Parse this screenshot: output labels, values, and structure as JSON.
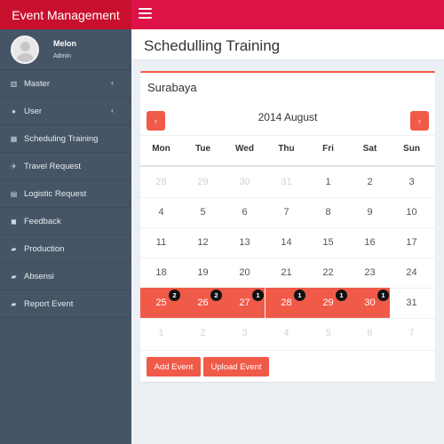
{
  "app": {
    "brand": "Event Management"
  },
  "user": {
    "name": "Melon",
    "role": "Admin"
  },
  "sidebar": {
    "items": [
      {
        "label": "Master",
        "icon": "bar-chart-icon",
        "glyph": "▥",
        "has_submenu": true
      },
      {
        "label": "User",
        "icon": "user-icon",
        "glyph": "●",
        "has_submenu": true
      },
      {
        "label": "Scheduling Training",
        "icon": "calendar-icon",
        "glyph": "▦",
        "has_submenu": false
      },
      {
        "label": "Travel Request",
        "icon": "plane-icon",
        "glyph": "✈",
        "has_submenu": false
      },
      {
        "label": "Logistic Request",
        "icon": "briefcase-icon",
        "glyph": "▤",
        "has_submenu": false
      },
      {
        "label": "Feedback",
        "icon": "comments-icon",
        "glyph": "◼",
        "has_submenu": false
      },
      {
        "label": "Production",
        "icon": "book-icon",
        "glyph": "▰",
        "has_submenu": false
      },
      {
        "label": "Absensi",
        "icon": "book-icon",
        "glyph": "▰",
        "has_submenu": false
      },
      {
        "label": "Report Event",
        "icon": "book-icon",
        "glyph": "▰",
        "has_submenu": false
      }
    ],
    "submenu_glyph": "‹"
  },
  "page": {
    "title": "Schedulling Training"
  },
  "calendar": {
    "location": "Surabaya",
    "month_label": "2014 August",
    "prev_glyph": "‹",
    "next_glyph": "›",
    "weekdays": [
      "Mon",
      "Tue",
      "Wed",
      "Thu",
      "Fri",
      "Sat",
      "Sun"
    ],
    "weeks": [
      [
        {
          "d": "28",
          "m": true
        },
        {
          "d": "29",
          "m": true
        },
        {
          "d": "30",
          "m": true
        },
        {
          "d": "31",
          "m": true
        },
        {
          "d": "1"
        },
        {
          "d": "2"
        },
        {
          "d": "3"
        }
      ],
      [
        {
          "d": "4"
        },
        {
          "d": "5"
        },
        {
          "d": "6"
        },
        {
          "d": "7"
        },
        {
          "d": "8"
        },
        {
          "d": "9"
        },
        {
          "d": "10"
        }
      ],
      [
        {
          "d": "11"
        },
        {
          "d": "12"
        },
        {
          "d": "13"
        },
        {
          "d": "14"
        },
        {
          "d": "15"
        },
        {
          "d": "16"
        },
        {
          "d": "17"
        }
      ],
      [
        {
          "d": "18"
        },
        {
          "d": "19"
        },
        {
          "d": "20"
        },
        {
          "d": "21"
        },
        {
          "d": "22"
        },
        {
          "d": "23"
        },
        {
          "d": "24"
        }
      ],
      [
        {
          "d": "25",
          "ev": true,
          "badge": "2"
        },
        {
          "d": "26",
          "ev": true,
          "badge": "2"
        },
        {
          "d": "27",
          "ev": true,
          "badge": "1"
        },
        {
          "d": "28",
          "ev": true,
          "badge": "1"
        },
        {
          "d": "29",
          "ev": true,
          "badge": "1"
        },
        {
          "d": "30",
          "ev": true,
          "badge": "1"
        },
        {
          "d": "31"
        }
      ],
      [
        {
          "d": "1",
          "m": true
        },
        {
          "d": "2",
          "m": true
        },
        {
          "d": "3",
          "m": true
        },
        {
          "d": "4",
          "m": true
        },
        {
          "d": "5",
          "m": true
        },
        {
          "d": "6",
          "m": true
        },
        {
          "d": "7",
          "m": true
        }
      ]
    ],
    "event_color": "#f05a48"
  },
  "actions": {
    "add_event": "Add Event",
    "upload_event": "Upload Event"
  },
  "colors": {
    "brand": "#c8102e",
    "topbar": "#dd1247",
    "sidebar": "#465566",
    "accent": "#f05a48"
  }
}
